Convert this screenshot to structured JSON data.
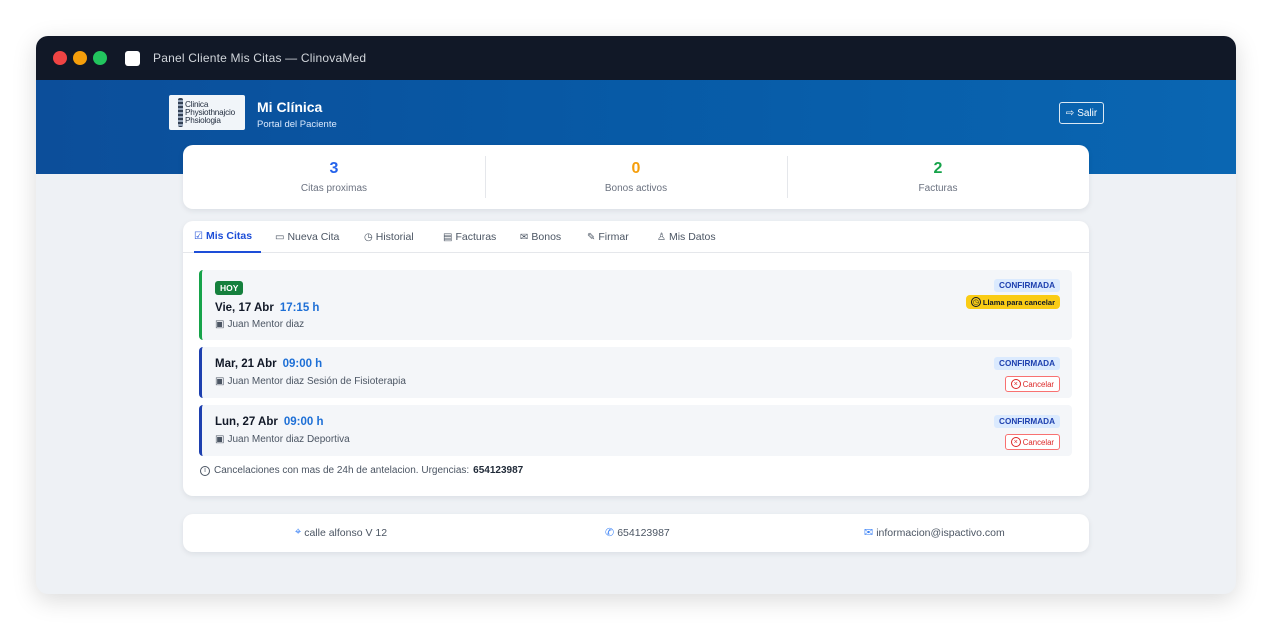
{
  "window": {
    "title": "Panel Cliente Mis Citas  —  ClinovaMed"
  },
  "header": {
    "logo_lines": [
      "Clinica",
      "Physiothnajcio",
      "Phsiologia"
    ],
    "clinic_name": "Mi Clínica",
    "subtitle": "Portal del Paciente",
    "logout_label": "Salir"
  },
  "stats": [
    {
      "value": "3",
      "label": "Citas proximas",
      "color": "#2563eb"
    },
    {
      "value": "0",
      "label": "Bonos activos",
      "color": "#f59e0b"
    },
    {
      "value": "2",
      "label": "Facturas",
      "color": "#16a34a"
    }
  ],
  "tabs": [
    {
      "label": "Mis Citas",
      "icon": "calendar-check-icon",
      "glyph": "☑"
    },
    {
      "label": "Nueva Cita",
      "icon": "calendar-plus-icon",
      "glyph": "▭"
    },
    {
      "label": "Historial",
      "icon": "clock-icon",
      "glyph": "◷"
    },
    {
      "label": "Facturas",
      "icon": "invoice-icon",
      "glyph": "▤"
    },
    {
      "label": "Bonos",
      "icon": "ticket-icon",
      "glyph": "✉"
    },
    {
      "label": "Firmar",
      "icon": "pen-icon",
      "glyph": "✎"
    },
    {
      "label": "Mis Datos",
      "icon": "user-gear-icon",
      "glyph": "♙"
    }
  ],
  "appointments": [
    {
      "today_badge": "HOY",
      "date": "Vie, 17 Abr",
      "time": "17:15 h",
      "professional": "Juan Mentor diaz",
      "status": "CONFIRMADA",
      "action": "Llama para cancelar"
    },
    {
      "date": "Mar, 21 Abr",
      "time": "09:00 h",
      "professional": "Juan Mentor diaz Sesión de Fisioterapia",
      "status": "CONFIRMADA",
      "action": "Cancelar"
    },
    {
      "date": "Lun, 27 Abr",
      "time": "09:00 h",
      "professional": "Juan Mentor diaz Deportiva",
      "status": "CONFIRMADA",
      "action": "Cancelar"
    }
  ],
  "note": {
    "text": "Cancelaciones con mas de 24h de antelacion. Urgencias:",
    "phone": "654123987"
  },
  "footer": {
    "address": "calle alfonso V 12",
    "phone": "654123987",
    "email": "informacion@ispactivo.com"
  }
}
